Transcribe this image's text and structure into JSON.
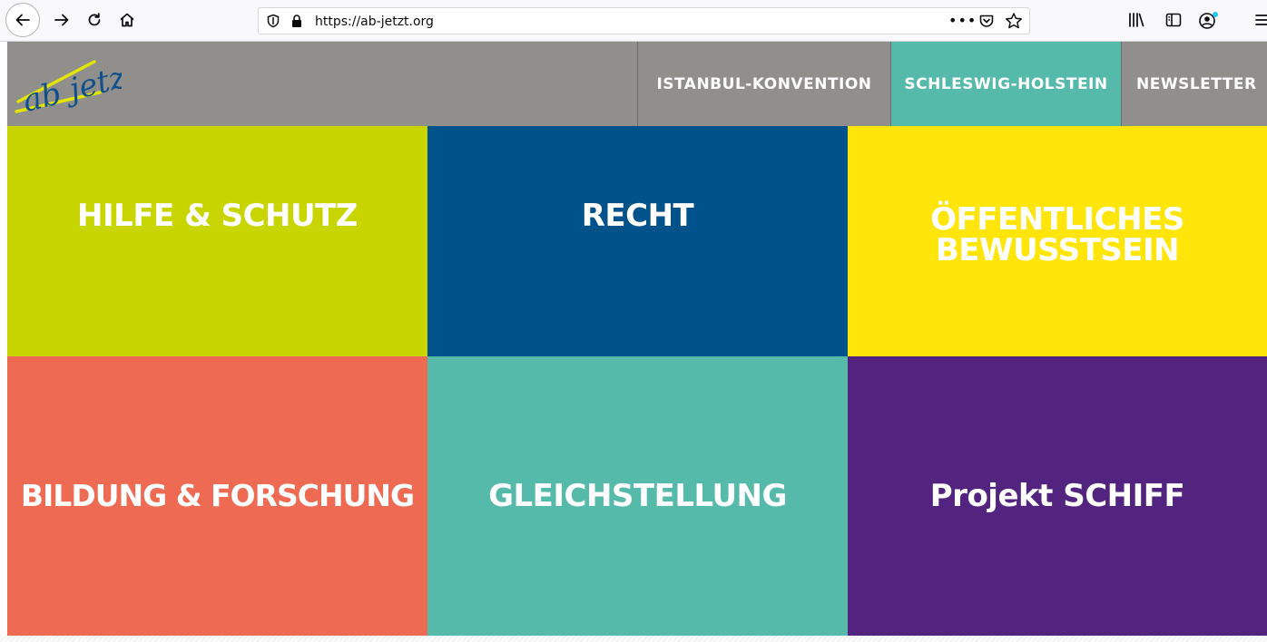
{
  "browser": {
    "url": "https://ab-jetzt.org"
  },
  "site": {
    "logo_text": "ab jetzt!",
    "nav": [
      {
        "label": "ISTANBUL-KONVENTION"
      },
      {
        "label": "SCHLESWIG-HOLSTEIN",
        "active": true
      },
      {
        "label": "NEWSLETTER"
      }
    ],
    "tiles": [
      {
        "label": "HILFE & SCHUTZ",
        "color": "#c9d500"
      },
      {
        "label": "RECHT",
        "color": "#00528a"
      },
      {
        "label_line1": "ÖFFENTLICHES",
        "label_line2": "BEWUSSTSEIN",
        "color": "#ffe50a"
      },
      {
        "label": "BILDUNG & FORSCHUNG",
        "color": "#ee6a53"
      },
      {
        "label": "GLEICHSTELLUNG",
        "color": "#55baa9"
      },
      {
        "label": "Projekt SCHIFF",
        "color": "#52247f"
      }
    ],
    "header_color": "#908f8c",
    "active_nav_color": "#55baa9"
  },
  "icons": [
    "back-arrow-icon",
    "forward-arrow-icon",
    "reload-icon",
    "home-icon",
    "shield-icon",
    "lock-icon",
    "more-icon",
    "pocket-icon",
    "star-icon",
    "library-icon",
    "sidebar-icon",
    "account-icon",
    "menu-icon"
  ]
}
